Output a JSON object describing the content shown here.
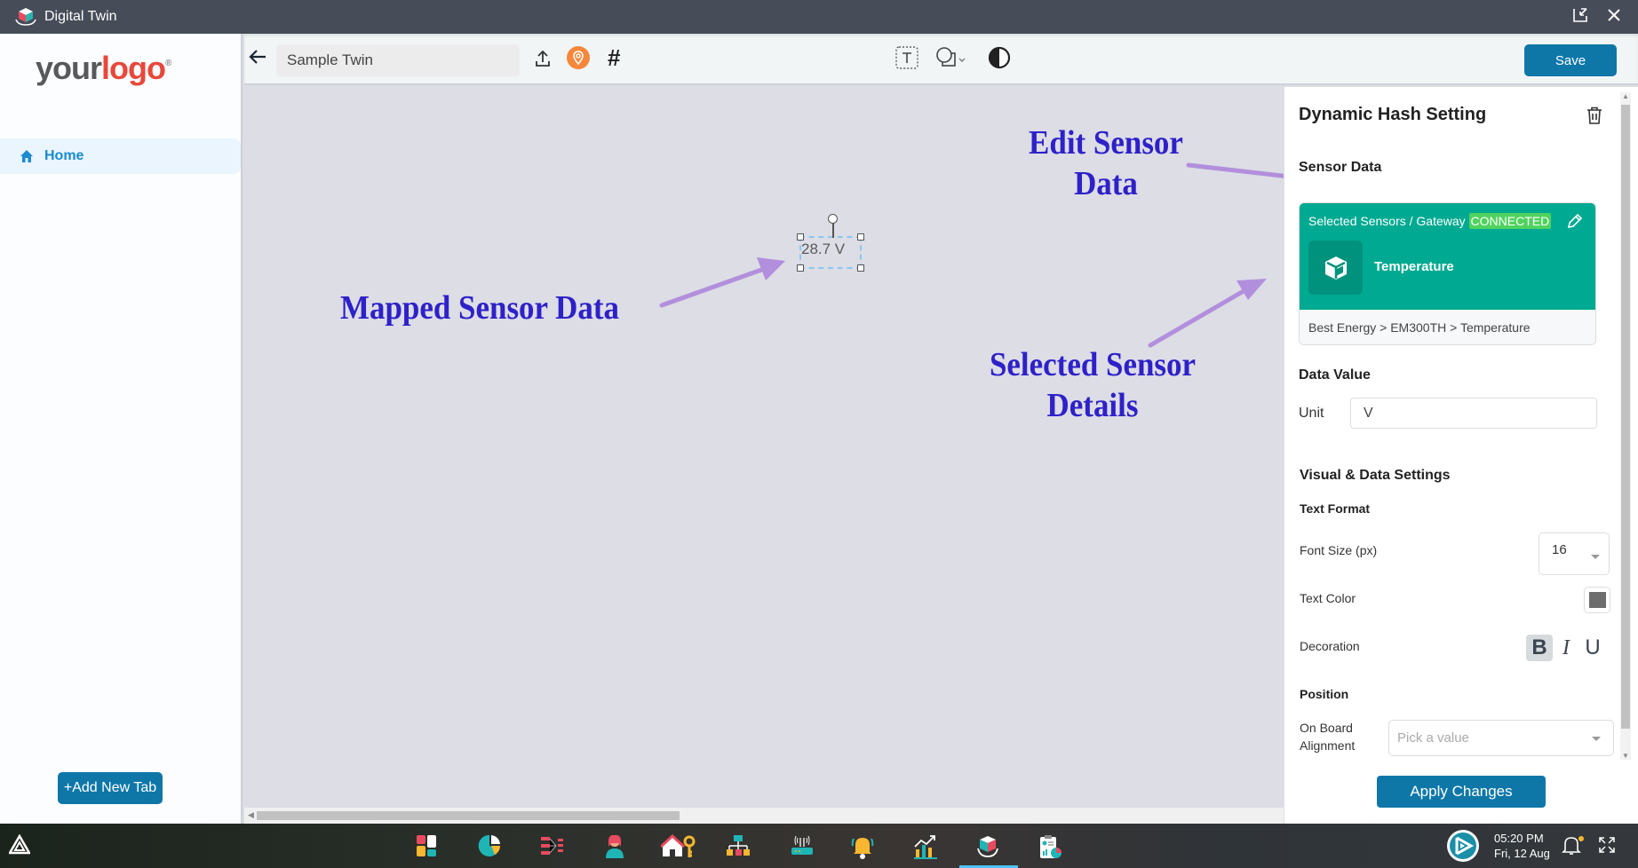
{
  "window": {
    "title": "Digital Twin",
    "controls": {
      "restore_icon": "restore-window-icon",
      "close_icon": "close-icon"
    }
  },
  "sidebar": {
    "logo": {
      "part1": "your",
      "part2": "logo",
      "mark": "®"
    },
    "nav": [
      {
        "label": "Home",
        "icon": "home-icon",
        "active": true
      }
    ],
    "add_tab_label": "+Add New Tab"
  },
  "toolbar": {
    "back_icon": "arrow-left-icon",
    "twin_name": "Sample Twin",
    "icons": [
      "upload-icon",
      "location-pin-icon",
      "hash-icon",
      "text-tool-icon",
      "shapes-icon",
      "contrast-icon"
    ],
    "save_label": "Save"
  },
  "canvas": {
    "widget_value": "28.7 V",
    "annotations": {
      "mapped": "Mapped Sensor Data",
      "edit_line1": "Edit Sensor",
      "edit_line2": "Data",
      "selected_line1": "Selected Sensor",
      "selected_line2": "Details"
    },
    "annotation_color": "#2e21c8",
    "arrow_color": "#b28fdc"
  },
  "panel": {
    "title": "Dynamic Hash Setting",
    "sensor_data_heading": "Sensor Data",
    "sensor_card": {
      "selected_label": "Selected Sensors / Gateway",
      "status": "CONNECTED",
      "sensor_name": "Temperature",
      "path": "Best Energy > EM300TH > Temperature",
      "color": "#00a991"
    },
    "data_value_heading": "Data Value",
    "unit_label": "Unit",
    "unit_value": "V",
    "visual_heading": "Visual & Data Settings",
    "text_format_heading": "Text Format",
    "font_size_label": "Font Size (px)",
    "font_size_value": "16",
    "text_color_label": "Text Color",
    "text_color_value": "#6d6d6d",
    "decoration_label": "Decoration",
    "decoration": {
      "bold": "B",
      "italic": "I",
      "underline": "U",
      "bold_active": true
    },
    "position_heading": "Position",
    "alignment_label_1": "On Board",
    "alignment_label_2": "Alignment",
    "alignment_placeholder": "Pick a value",
    "apply_label": "Apply Changes"
  },
  "taskbar": {
    "apps": [
      "dashboard-app-icon",
      "analytics-app-icon",
      "flow-app-icon",
      "user-app-icon",
      "home-access-app-icon",
      "hierarchy-app-icon",
      "gateway-app-icon",
      "alarm-app-icon",
      "reports-app-icon",
      "digital-twin-app-icon",
      "clipboard-report-app-icon"
    ],
    "active_app": "digital-twin-app-icon",
    "time": "05:20 PM",
    "date": "Fri, 12 Aug"
  }
}
